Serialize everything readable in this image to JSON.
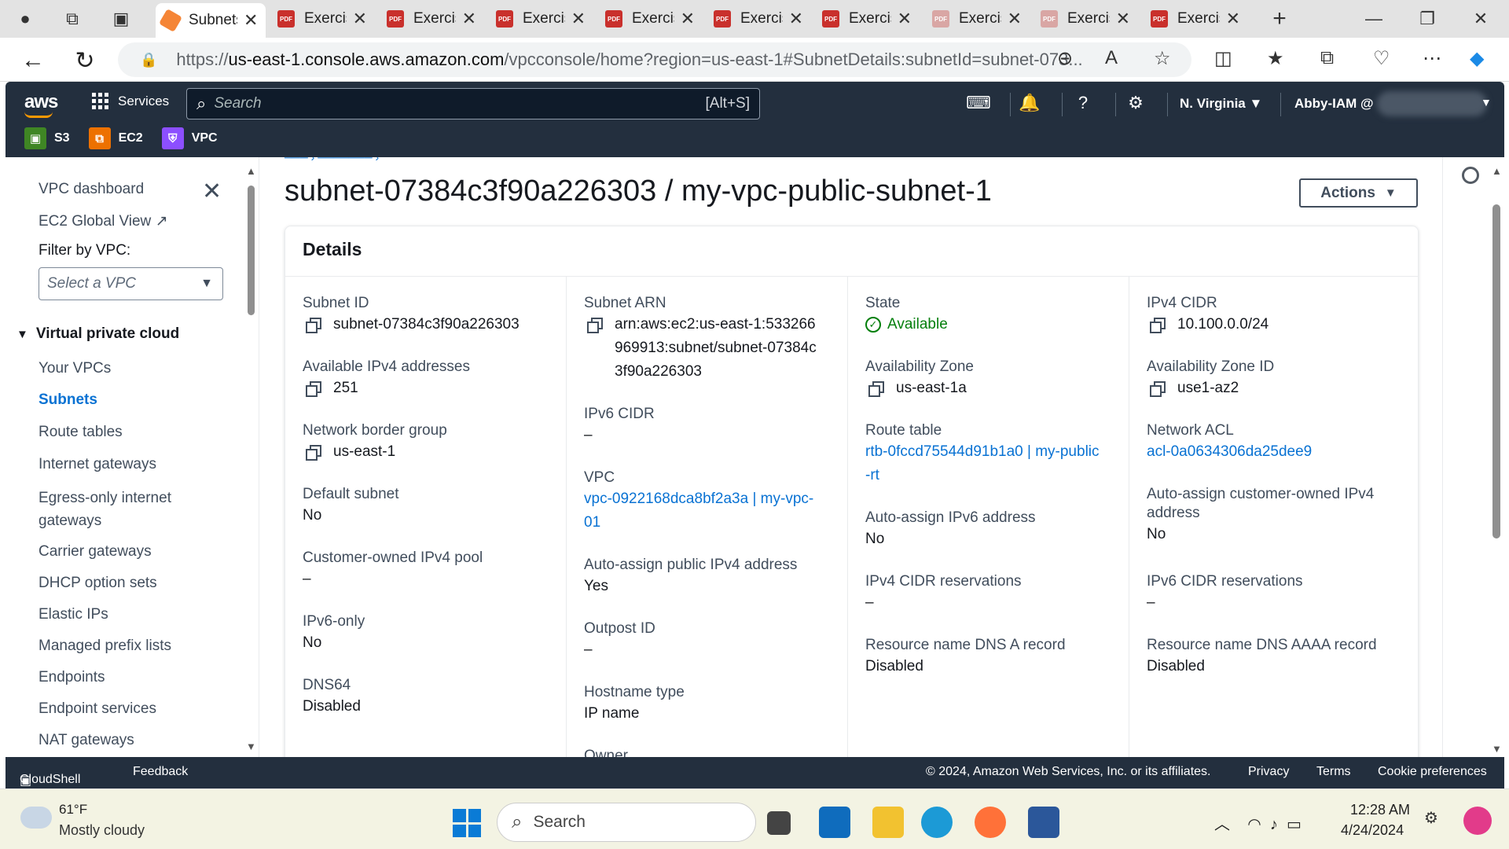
{
  "browser": {
    "tabs": [
      {
        "title": "Subnets",
        "icon": "aws-icon",
        "active": true
      },
      {
        "title": "Exercise",
        "icon": "pdf-icon"
      },
      {
        "title": "Exercise",
        "icon": "pdf-icon"
      },
      {
        "title": "Exercise",
        "icon": "pdf-icon"
      },
      {
        "title": "Exercise",
        "icon": "pdf-icon"
      },
      {
        "title": "Exercise",
        "icon": "pdf-icon"
      },
      {
        "title": "Exercise",
        "icon": "pdf-icon"
      },
      {
        "title": "Exercise",
        "icon": "pdf-icon"
      },
      {
        "title": "Exercise",
        "icon": "pdf-icon"
      },
      {
        "title": "Exercise",
        "icon": "pdf-icon"
      }
    ],
    "url_prefix": "https://",
    "url_host": "us-east-1.console.aws.amazon.com",
    "url_path": "/vpcconsole/home?region=us-east-1#SubnetDetails:subnetId=subnet-073..."
  },
  "aws": {
    "logo": "aws",
    "services_label": "Services",
    "search_placeholder": "Search",
    "search_shortcut": "[Alt+S]",
    "region": "N. Virginia",
    "user": "Abby-IAM @",
    "favorites": [
      {
        "label": "S3",
        "color": "#3f8624"
      },
      {
        "label": "EC2",
        "color": "#ed7100"
      },
      {
        "label": "VPC",
        "color": "#8c4fff"
      }
    ]
  },
  "sidebar": {
    "dashboard": "VPC dashboard",
    "global_view": "EC2 Global View",
    "filter_label": "Filter by VPC:",
    "filter_placeholder": "Select a VPC",
    "section": "Virtual private cloud",
    "items": [
      "Your VPCs",
      "Subnets",
      "Route tables",
      "Internet gateways",
      "Egress-only internet gateways",
      "Carrier gateways",
      "DHCP option sets",
      "Elastic IPs",
      "Managed prefix lists",
      "Endpoints",
      "Endpoint services",
      "NAT gateways"
    ],
    "active_item": "Subnets"
  },
  "main": {
    "title": "subnet-07384c3f90a226303 / my-vpc-public-subnet-1",
    "actions_label": "Actions",
    "panel_title": "Details",
    "columns": [
      [
        {
          "label": "Subnet ID",
          "value": "subnet-07384c3f90a226303",
          "copy": true
        },
        {
          "label": "Available IPv4 addresses",
          "value": "251",
          "copy": true
        },
        {
          "label": "Network border group",
          "value": "us-east-1",
          "copy": true
        },
        {
          "label": "Default subnet",
          "value": "No"
        },
        {
          "label": "Customer-owned IPv4 pool",
          "value": "–"
        },
        {
          "label": "IPv6-only",
          "value": "No"
        },
        {
          "label": "DNS64",
          "value": "Disabled"
        }
      ],
      [
        {
          "label": "Subnet ARN",
          "value": "arn:aws:ec2:us-east-1:533266969913:subnet/subnet-07384c3f90a226303",
          "copy": true
        },
        {
          "label": "IPv6 CIDR",
          "value": "–"
        },
        {
          "label": "VPC",
          "value": "vpc-0922168dca8bf2a3a | my-vpc-01",
          "link": true
        },
        {
          "label": "Auto-assign public IPv4 address",
          "value": "Yes"
        },
        {
          "label": "Outpost ID",
          "value": "–"
        },
        {
          "label": "Hostname type",
          "value": "IP name"
        },
        {
          "label": "Owner",
          "value": ""
        }
      ],
      [
        {
          "label": "State",
          "value": "Available",
          "status": true
        },
        {
          "label": "Availability Zone",
          "value": "us-east-1a",
          "copy": true
        },
        {
          "label": "Route table",
          "value": "rtb-0fccd75544d91b1a0 | my-public-rt",
          "link": true
        },
        {
          "label": "Auto-assign IPv6 address",
          "value": "No"
        },
        {
          "label": "IPv4 CIDR reservations",
          "value": "–"
        },
        {
          "label": "Resource name DNS A record",
          "value": "Disabled"
        }
      ],
      [
        {
          "label": "IPv4 CIDR",
          "value": "10.100.0.0/24",
          "copy": true
        },
        {
          "label": "Availability Zone ID",
          "value": "use1-az2",
          "copy": true
        },
        {
          "label": "Network ACL",
          "value": "acl-0a0634306da25dee9",
          "link": true
        },
        {
          "label": "Auto-assign customer-owned IPv4 address",
          "value": "No"
        },
        {
          "label": "IPv6 CIDR reservations",
          "value": "–"
        },
        {
          "label": "Resource name DNS AAAA record",
          "value": "Disabled"
        }
      ]
    ]
  },
  "footer": {
    "cloudshell": "CloudShell",
    "feedback": "Feedback",
    "copyright": "© 2024, Amazon Web Services, Inc. or its affiliates.",
    "privacy": "Privacy",
    "terms": "Terms",
    "cookies": "Cookie preferences"
  },
  "taskbar": {
    "temperature": "61°F",
    "weather": "Mostly cloudy",
    "search_placeholder": "Search",
    "time": "12:28 AM",
    "date": "4/24/2024"
  }
}
